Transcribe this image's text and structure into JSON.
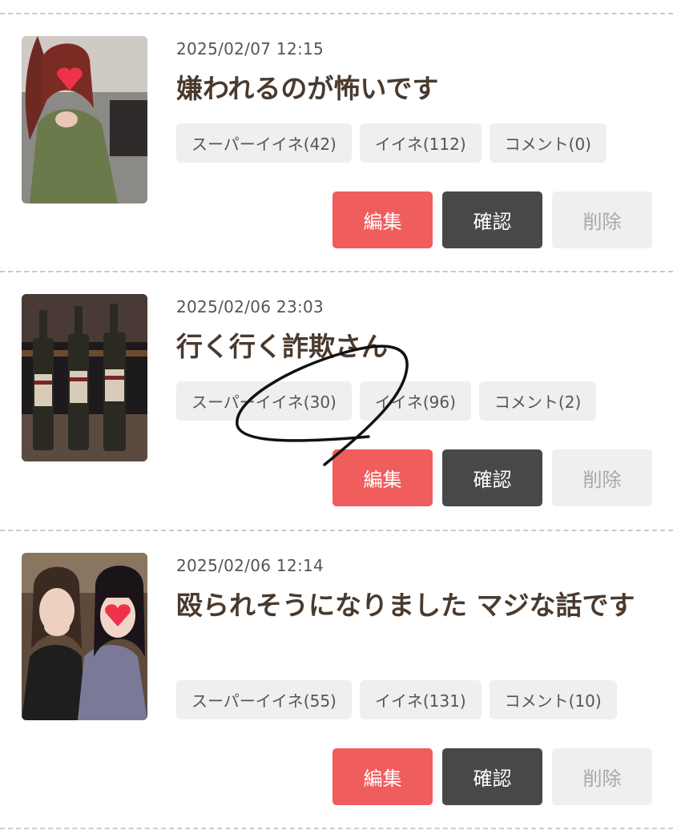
{
  "posts": [
    {
      "date": "2025/02/07 12:15",
      "title": "嫌われるのが怖いです",
      "chips": [
        "スーパーイイネ(42)",
        "イイネ(112)",
        "コメント(0)"
      ],
      "actions": {
        "edit": "編集",
        "check": "確認",
        "delete": "削除"
      }
    },
    {
      "date": "2025/02/06 23:03",
      "title": "行く行く詐欺さん",
      "chips": [
        "スーパーイイネ(30)",
        "イイネ(96)",
        "コメント(2)"
      ],
      "actions": {
        "edit": "編集",
        "check": "確認",
        "delete": "削除"
      }
    },
    {
      "date": "2025/02/06 12:14",
      "title": "殴られそうになりました マジな話です",
      "chips": [
        "スーパーイイネ(55)",
        "イイネ(131)",
        "コメント(10)"
      ],
      "actions": {
        "edit": "編集",
        "check": "確認",
        "delete": "削除"
      }
    }
  ],
  "colors": {
    "edit": "#ef5d5d",
    "check": "#484848",
    "delete": "#efefef",
    "title": "#4a3a2e"
  }
}
